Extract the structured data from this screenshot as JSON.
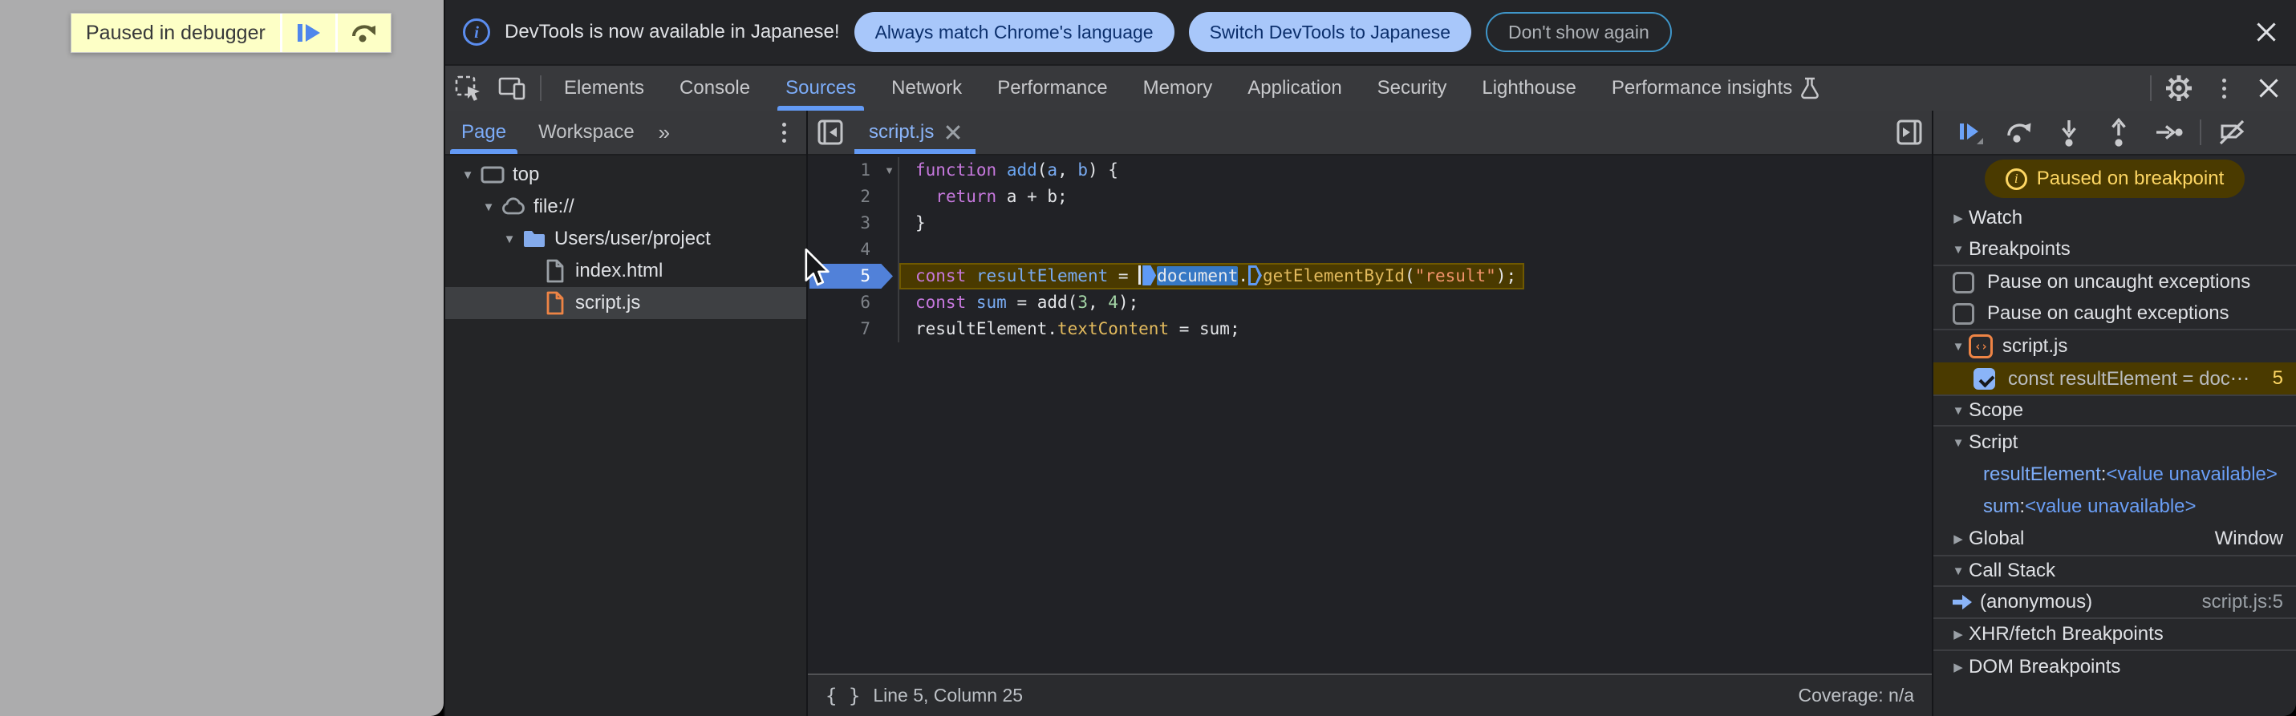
{
  "page": {
    "banner": {
      "label": "Paused in debugger"
    }
  },
  "infobar": {
    "message": "DevTools is now available in Japanese!",
    "buttons": [
      {
        "label": "Always match Chrome's language",
        "style": "filled"
      },
      {
        "label": "Switch DevTools to Japanese",
        "style": "filled"
      },
      {
        "label": "Don't show again",
        "style": "outline"
      }
    ]
  },
  "main_tabs": {
    "items": [
      {
        "label": "Elements"
      },
      {
        "label": "Console"
      },
      {
        "label": "Sources",
        "active": true
      },
      {
        "label": "Network"
      },
      {
        "label": "Performance"
      },
      {
        "label": "Memory"
      },
      {
        "label": "Application"
      },
      {
        "label": "Security"
      },
      {
        "label": "Lighthouse"
      },
      {
        "label": "Performance insights",
        "flask": true
      }
    ]
  },
  "sidebar": {
    "tabs": [
      {
        "label": "Page",
        "active": true
      },
      {
        "label": "Workspace"
      }
    ],
    "tree": [
      {
        "label": "top",
        "icon": "frame",
        "level": 0,
        "arrow": true
      },
      {
        "label": "file://",
        "icon": "cloud",
        "level": 1,
        "arrow": true
      },
      {
        "label": "Users/user/project",
        "icon": "folder",
        "level": 2,
        "arrow": true
      },
      {
        "label": "index.html",
        "icon": "file-gray",
        "level": 3,
        "arrow": false
      },
      {
        "label": "script.js",
        "icon": "file-orange",
        "level": 3,
        "arrow": false,
        "selected": true
      }
    ]
  },
  "editor": {
    "tab_label": "script.js",
    "lines": [
      {
        "n": 1,
        "fold": true,
        "tokens": [
          [
            "kw",
            "function"
          ],
          [
            "pl",
            " "
          ],
          [
            "fn",
            "add"
          ],
          [
            "pl",
            "("
          ],
          [
            "def",
            "a"
          ],
          [
            "pl",
            ", "
          ],
          [
            "def",
            "b"
          ],
          [
            "pl",
            ") {"
          ]
        ]
      },
      {
        "n": 2,
        "tokens": [
          [
            "pl",
            "  "
          ],
          [
            "kw",
            "return"
          ],
          [
            "pl",
            " a + b;"
          ]
        ]
      },
      {
        "n": 3,
        "tokens": [
          [
            "pl",
            "}"
          ]
        ]
      },
      {
        "n": 4,
        "tokens": []
      },
      {
        "n": 5,
        "exec": true,
        "tokens": [
          [
            "kw",
            "const"
          ],
          [
            "pl",
            " "
          ],
          [
            "def",
            "resultElement"
          ],
          [
            "pl",
            " = "
          ],
          [
            "caret",
            ""
          ],
          [
            "mk-filled",
            ""
          ],
          [
            "sel",
            "document"
          ],
          [
            "pl",
            "."
          ],
          [
            "mk-hollow",
            ""
          ],
          [
            "prop",
            "getElementById"
          ],
          [
            "pl",
            "("
          ],
          [
            "str",
            "\"result\""
          ],
          [
            "pl",
            ");"
          ]
        ]
      },
      {
        "n": 6,
        "tokens": [
          [
            "kw",
            "const"
          ],
          [
            "pl",
            " "
          ],
          [
            "def",
            "sum"
          ],
          [
            "pl",
            " = add("
          ],
          [
            "num",
            "3"
          ],
          [
            "pl",
            ", "
          ],
          [
            "num",
            "4"
          ],
          [
            "pl",
            ");"
          ]
        ]
      },
      {
        "n": 7,
        "tokens": [
          [
            "pl",
            "resultElement."
          ],
          [
            "prop",
            "textContent"
          ],
          [
            "pl",
            " = sum;"
          ]
        ]
      }
    ],
    "status": {
      "position": "Line 5, Column 25",
      "coverage": "Coverage: n/a"
    }
  },
  "debugger": {
    "paused_badge": "Paused on breakpoint",
    "rows": [
      {
        "type": "section",
        "label": "Watch",
        "arrow": "right"
      },
      {
        "type": "section",
        "label": "Breakpoints",
        "arrow": "down",
        "rule": "below"
      },
      {
        "type": "checkbox",
        "label": "Pause on uncaught exceptions",
        "checked": false
      },
      {
        "type": "checkbox",
        "label": "Pause on caught exceptions",
        "checked": false,
        "rule": "below"
      },
      {
        "type": "group",
        "label": "script.js",
        "arrow": "down",
        "icon": "script-orange"
      },
      {
        "type": "bp",
        "label": "const resultElement = doc⋯",
        "line": "5",
        "checked": true
      },
      {
        "type": "section",
        "label": "Scope",
        "arrow": "down",
        "rule": "above below"
      },
      {
        "type": "scopegroup",
        "label": "Script",
        "arrow": "down"
      },
      {
        "type": "scopevar",
        "name": "resultElement",
        "sep": ": ",
        "value": "<value unavailable>"
      },
      {
        "type": "scopevar",
        "name": "sum",
        "sep": ": ",
        "value": "<value unavailable>"
      },
      {
        "type": "kv",
        "label": "Global",
        "arrow": "right",
        "right": "Window"
      },
      {
        "type": "section",
        "label": "Call Stack",
        "arrow": "down",
        "rule": "above below"
      },
      {
        "type": "frame",
        "label": "(anonymous)",
        "right": "script.js:5",
        "rule": "below"
      },
      {
        "type": "section",
        "label": "XHR/fetch Breakpoints",
        "arrow": "right",
        "rule": "below"
      },
      {
        "type": "section",
        "label": "DOM Breakpoints",
        "arrow": "right"
      }
    ]
  }
}
